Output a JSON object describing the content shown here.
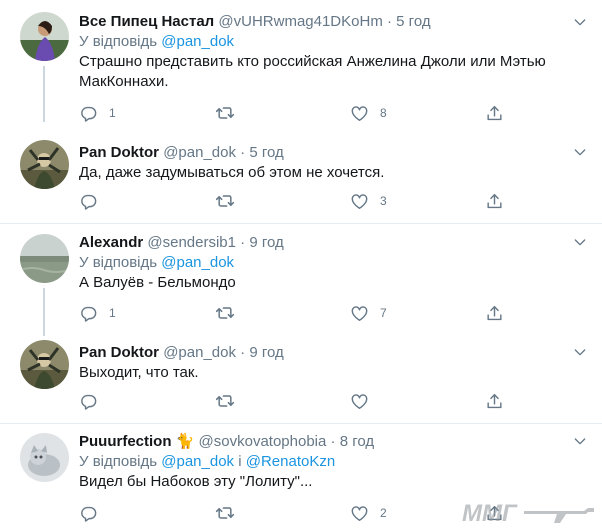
{
  "tweets": [
    {
      "name": "Все Пипец Настал",
      "handle": "@vUHRwmag41DKoHm",
      "dot": "·",
      "time": "5 год",
      "reply_prefix": "У відповідь",
      "reply_to_1": "@pan_dok",
      "reply_sep": "",
      "reply_to_2": "",
      "text": "Страшно представить кто российская Анжелина Джоли или Мэтью МакКоннахи.",
      "replies": "1",
      "retweets": "",
      "likes": "8",
      "emoji": ""
    },
    {
      "name": "Pan Doktor",
      "handle": "@pan_dok",
      "dot": "·",
      "time": "5 год",
      "text": "Да, даже задумываться об этом не хочется.",
      "replies": "",
      "retweets": "",
      "likes": "3"
    },
    {
      "name": "Alexandr",
      "handle": "@sendersib1",
      "dot": "·",
      "time": "9 год",
      "reply_prefix": "У відповідь",
      "reply_to_1": "@pan_dok",
      "text": "А Валуёв - Бельмондо",
      "replies": "1",
      "retweets": "",
      "likes": "7"
    },
    {
      "name": "Pan Doktor",
      "handle": "@pan_dok",
      "dot": "·",
      "time": "9 год",
      "text": "Выходит, что так.",
      "replies": "",
      "retweets": "",
      "likes": ""
    },
    {
      "name": "Puuurfection",
      "emoji": "🐈",
      "handle": "@sovkovatophobia",
      "dot": "·",
      "time": "8 год",
      "reply_prefix": "У відповідь",
      "reply_to_1": "@pan_dok",
      "reply_sep": "і",
      "reply_to_2": "@RenatoKzn",
      "text": "Видел бы Набоков эту \"Лолиту\"...",
      "replies": "",
      "retweets": "",
      "likes": "2"
    }
  ],
  "watermark": "ММГ",
  "colors": {
    "text": "#14171a",
    "secondary": "#657786",
    "link": "#1b95e0",
    "border": "#e6ecf0",
    "thread_line": "#ccd6dd"
  },
  "icons": [
    "reply-icon",
    "retweet-icon",
    "like-icon",
    "share-icon",
    "chevron-down-icon"
  ]
}
